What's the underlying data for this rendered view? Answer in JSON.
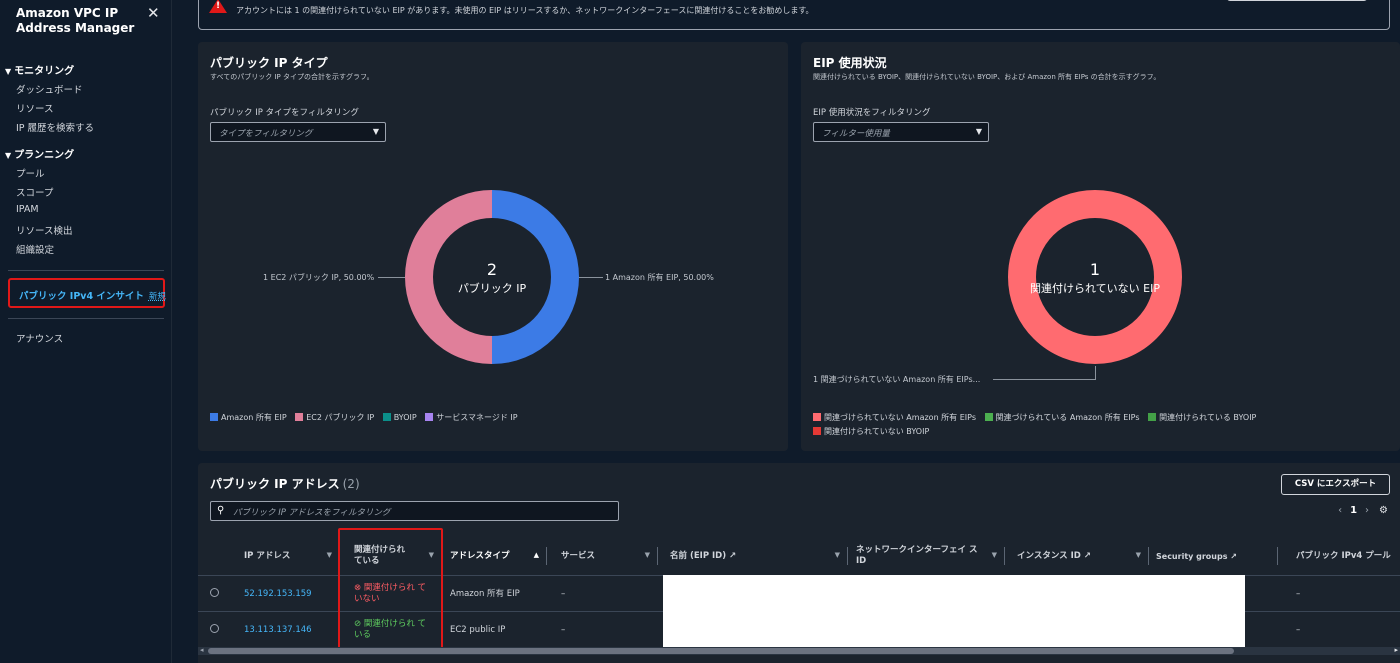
{
  "sidebar": {
    "title": "Amazon VPC IP Address Manager",
    "close_icon": "close-icon",
    "sections": [
      {
        "label": "モニタリング",
        "items": [
          "ダッシュボード",
          "リソース",
          "IP 履歴を検索する"
        ]
      },
      {
        "label": "プランニング",
        "items": [
          "プール",
          "スコープ",
          "IPAM",
          "リソース検出",
          "組織設定"
        ]
      }
    ],
    "highlight_item": "パブリック IPv4 インサイト",
    "highlight_badge": "新規",
    "announce": "アナウンス"
  },
  "alert": {
    "text": "アカウントには 1 の関連付けられていない EIP があります。未使用の EIP はリリースするか、ネットワークインターフェースに関連付けることをお勧めします。",
    "icon": "warning-icon"
  },
  "public_ip_types": {
    "title": "パブリック IP タイプ",
    "subtitle": "すべてのパブリック IP タイプの合計を示すグラフ。",
    "filter_label": "パブリック IP タイプをフィルタリング",
    "filter_placeholder": "タイプをフィルタリング",
    "center_value": "2",
    "center_label": "パブリック IP",
    "callout_left": "1 EC2 パブリック IP, 50.00%",
    "callout_right": "1 Amazon 所有 EIP, 50.00%",
    "legend": [
      "Amazon 所有 EIP",
      "EC2 パブリック IP",
      "BYOIP",
      "サービスマネージド IP"
    ],
    "colors": {
      "amazon_eip": "#3c7be6",
      "ec2_public": "#e07f9a",
      "byoip": "#0b8f8a",
      "service_managed": "#a784f0"
    }
  },
  "eip_usage": {
    "title": "EIP 使用状況",
    "subtitle": "関連付けられている BYOIP、関連付けられていない BYOIP、および Amazon 所有 EIPs の合計を示すグラフ。",
    "filter_label": "EIP 使用状況をフィルタリング",
    "filter_placeholder": "フィルター使用量",
    "center_value": "1",
    "center_label": "関連付けられていない EIP",
    "callout": "1 関連づけられていない Amazon 所有 EIPs...",
    "legend_row1": [
      "関連づけられていない Amazon 所有 EIPs",
      "関連づけられている Amazon 所有 EIPs",
      "関連付けられている BYOIP"
    ],
    "legend_row2": [
      "関連付けられていない BYOIP"
    ],
    "colors": {
      "unassoc_amazon": "#ff6b70",
      "assoc_amazon": "#4caf50",
      "assoc_byoip": "#43a047",
      "unassoc_byoip": "#e53935"
    }
  },
  "chart_data": [
    {
      "type": "pie",
      "title": "パブリック IP タイプ",
      "categories": [
        "Amazon 所有 EIP",
        "EC2 パブリック IP",
        "BYOIP",
        "サービスマネージド IP"
      ],
      "values": [
        1,
        1,
        0,
        0
      ]
    },
    {
      "type": "pie",
      "title": "EIP 使用状況",
      "categories": [
        "関連づけられていない Amazon 所有 EIPs",
        "関連づけられている Amazon 所有 EIPs",
        "関連付けられている BYOIP",
        "関連付けられていない BYOIP"
      ],
      "values": [
        1,
        0,
        0,
        0
      ]
    }
  ],
  "table": {
    "title": "パブリック IP アドレス",
    "count": "(2)",
    "search_placeholder": "パブリック IP アドレスをフィルタリング",
    "export_label": "CSV にエクスポート",
    "page": "1",
    "columns": [
      "IP アドレス",
      "関連付けられ ている",
      "アドレスタイプ",
      "サービス",
      "名前 (EIP ID)",
      "ネットワークインターフェイ ス ID",
      "インスタンス ID",
      "Security groups",
      "パブリック IPv4 プール"
    ],
    "rows": [
      {
        "ip": "52.192.153.159",
        "assoc": "関連付けられ ていない",
        "assoc_state": "bad",
        "type": "Amazon 所有 EIP",
        "service": "–",
        "pool": "–"
      },
      {
        "ip": "13.113.137.146",
        "assoc": "関連付けられ ている",
        "assoc_state": "ok",
        "type": "EC2 public IP",
        "service": "–",
        "pool": "–"
      }
    ]
  }
}
